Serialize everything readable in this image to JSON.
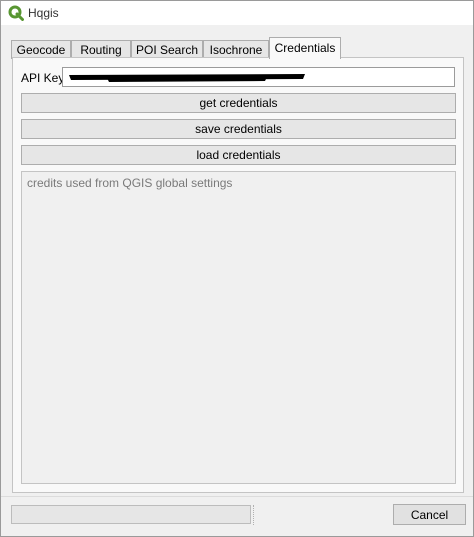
{
  "window": {
    "title": "Hqgis"
  },
  "tabs": [
    {
      "label": "Geocode"
    },
    {
      "label": "Routing"
    },
    {
      "label": "POI Search"
    },
    {
      "label": "Isochrone"
    },
    {
      "label": "Credentials",
      "active": true
    }
  ],
  "credentials": {
    "api_key_label": "API Key",
    "get_button": "get credentials",
    "save_button": "save credentials",
    "load_button": "load credentials",
    "log_text": "credits used from QGIS global settings"
  },
  "footer": {
    "progress": 0,
    "cancel_button": "Cancel"
  },
  "icons": {
    "app": "qgis-logo-icon"
  },
  "colors": {
    "qgis_green": "#589632",
    "tab_active_bg": "#f9f9f9",
    "panel_bg": "#f0f0f0"
  }
}
